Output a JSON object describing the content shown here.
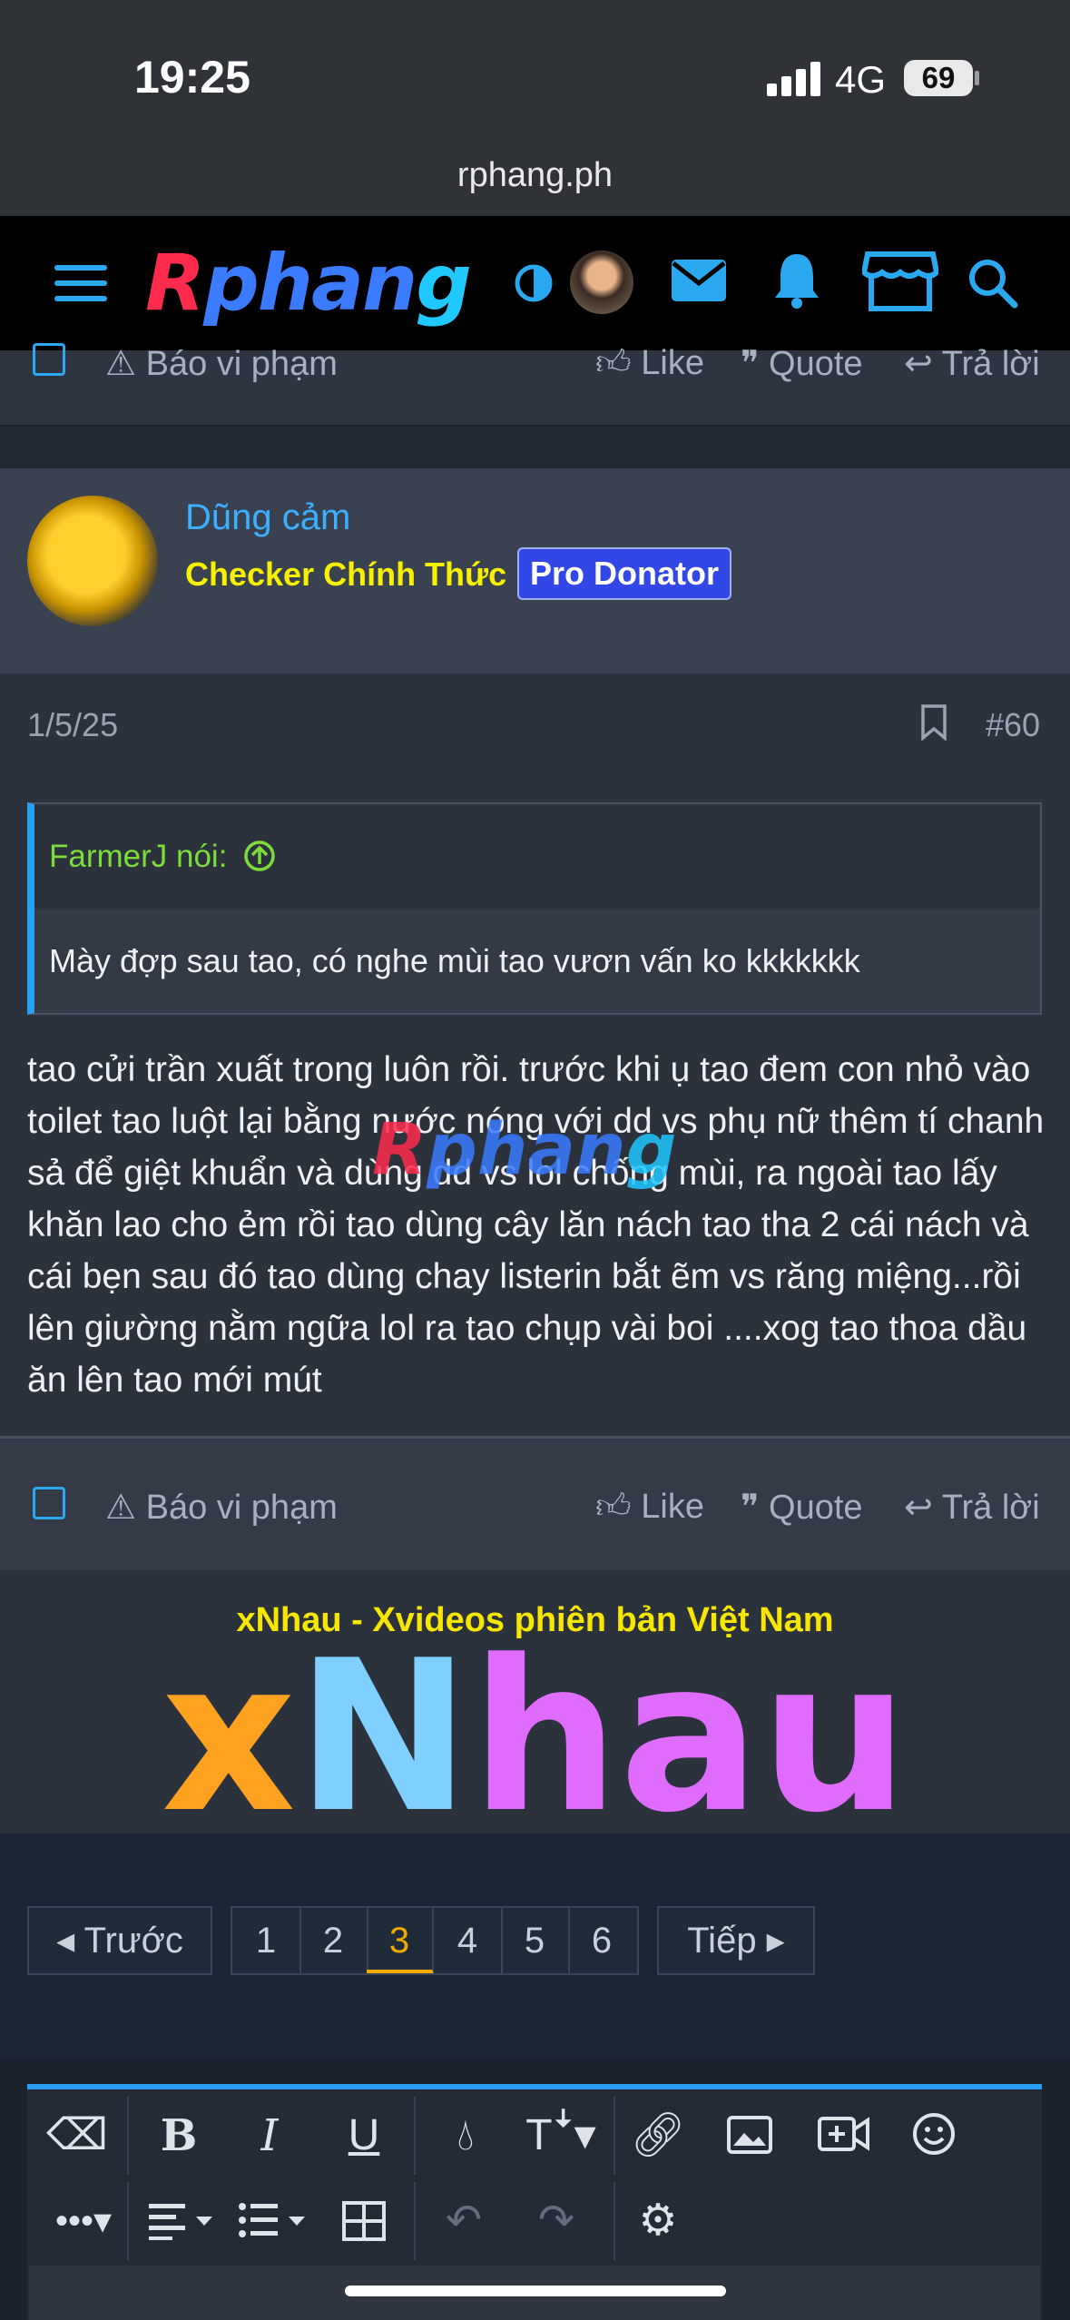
{
  "status_bar": {
    "time": "19:25",
    "network": "4G",
    "battery": "69"
  },
  "browser": {
    "url": "rphang.ph"
  },
  "nav": {
    "logo": [
      "R",
      "phan",
      "g"
    ]
  },
  "cut_actions": {
    "report": "Báo vi phạm",
    "like": "Like",
    "quote": "Quote",
    "reply": "Trả lời"
  },
  "post": {
    "username": "Dũng cảm",
    "rank": "Checker Chính Thức",
    "badge": "Pro Donator",
    "date": "1/5/25",
    "number": "#60",
    "quote_author": "FarmerJ nói:",
    "quote_text": "Mày đợp sau tao, có nghe mùi tao vươn vấn ko kkkkkkk",
    "message": "tao cửi trần xuất trong luôn rồi. trước khi ụ tao đem con nhỏ vào toilet tao luột lại bằng nước nóng với dd vs phụ nữ thêm tí chanh sả để giệt khuẩn và dùng dd vs lol chống mùi, ra ngoài tao lấy khăn lao cho ẻm rồi tao dùng cây lăn nách tao tha 2 cái nách và cái bẹn sau đó tao dùng chay listerin bắt ẽm vs răng miệng...rồi lên giường nằm ngữa lol ra tao chụp vài boi ....xog tao thoa dầu ăn lên tao mới mút",
    "watermark": [
      "R",
      "phan",
      "g"
    ]
  },
  "actions": {
    "report": "Báo vi phạm",
    "like": "Like",
    "quote": "Quote",
    "reply": "Trả lời"
  },
  "ad": {
    "title": "xNhau - Xvideos phiên bản Việt Nam",
    "logo": [
      "x",
      "N",
      "hau"
    ]
  },
  "pagination": {
    "prev": "Trước",
    "next": "Tiếp",
    "pages": [
      "1",
      "2",
      "3",
      "4",
      "5",
      "6"
    ],
    "current": "3"
  },
  "colors": {
    "accent": "#2aa9f0",
    "rank": "#f7f000",
    "badge": "#3147e6",
    "quote_author": "#7bdc3a",
    "current_page": "#f2a900"
  }
}
